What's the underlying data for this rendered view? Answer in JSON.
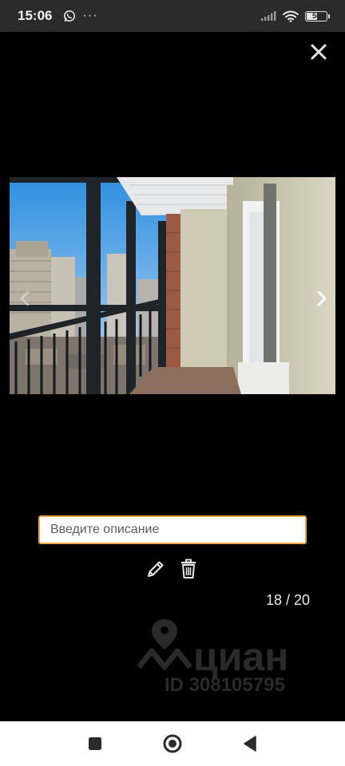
{
  "status_bar": {
    "time": "15:06",
    "notification_icons": [
      "whatsapp-icon"
    ],
    "overflow_dots": "···",
    "signal_icon": "signal-icon",
    "wifi_icon": "wifi-icon",
    "battery_level": "56",
    "battery_fraction": 0.56
  },
  "viewer": {
    "close_icon": "close-icon",
    "photo_description": "balcony-photo",
    "next_icon": "chevron-right-icon",
    "prev_icon": "chevron-left-icon"
  },
  "description": {
    "placeholder": "Введите описание",
    "value": ""
  },
  "actions": {
    "edit_icon": "pencil-icon",
    "delete_icon": "trash-icon"
  },
  "counter": "18 / 20",
  "watermark": {
    "logo_text": "циан",
    "id_text": "ID 308105795"
  },
  "nav": {
    "recents_icon": "square-icon",
    "home_icon": "circle-icon",
    "back_icon": "triangle-back-icon"
  },
  "colors": {
    "accent_border": "#f0a347",
    "background": "#000000",
    "status_bar_bg": "#2b2b2b",
    "nav_bar_bg": "#ffffff"
  }
}
